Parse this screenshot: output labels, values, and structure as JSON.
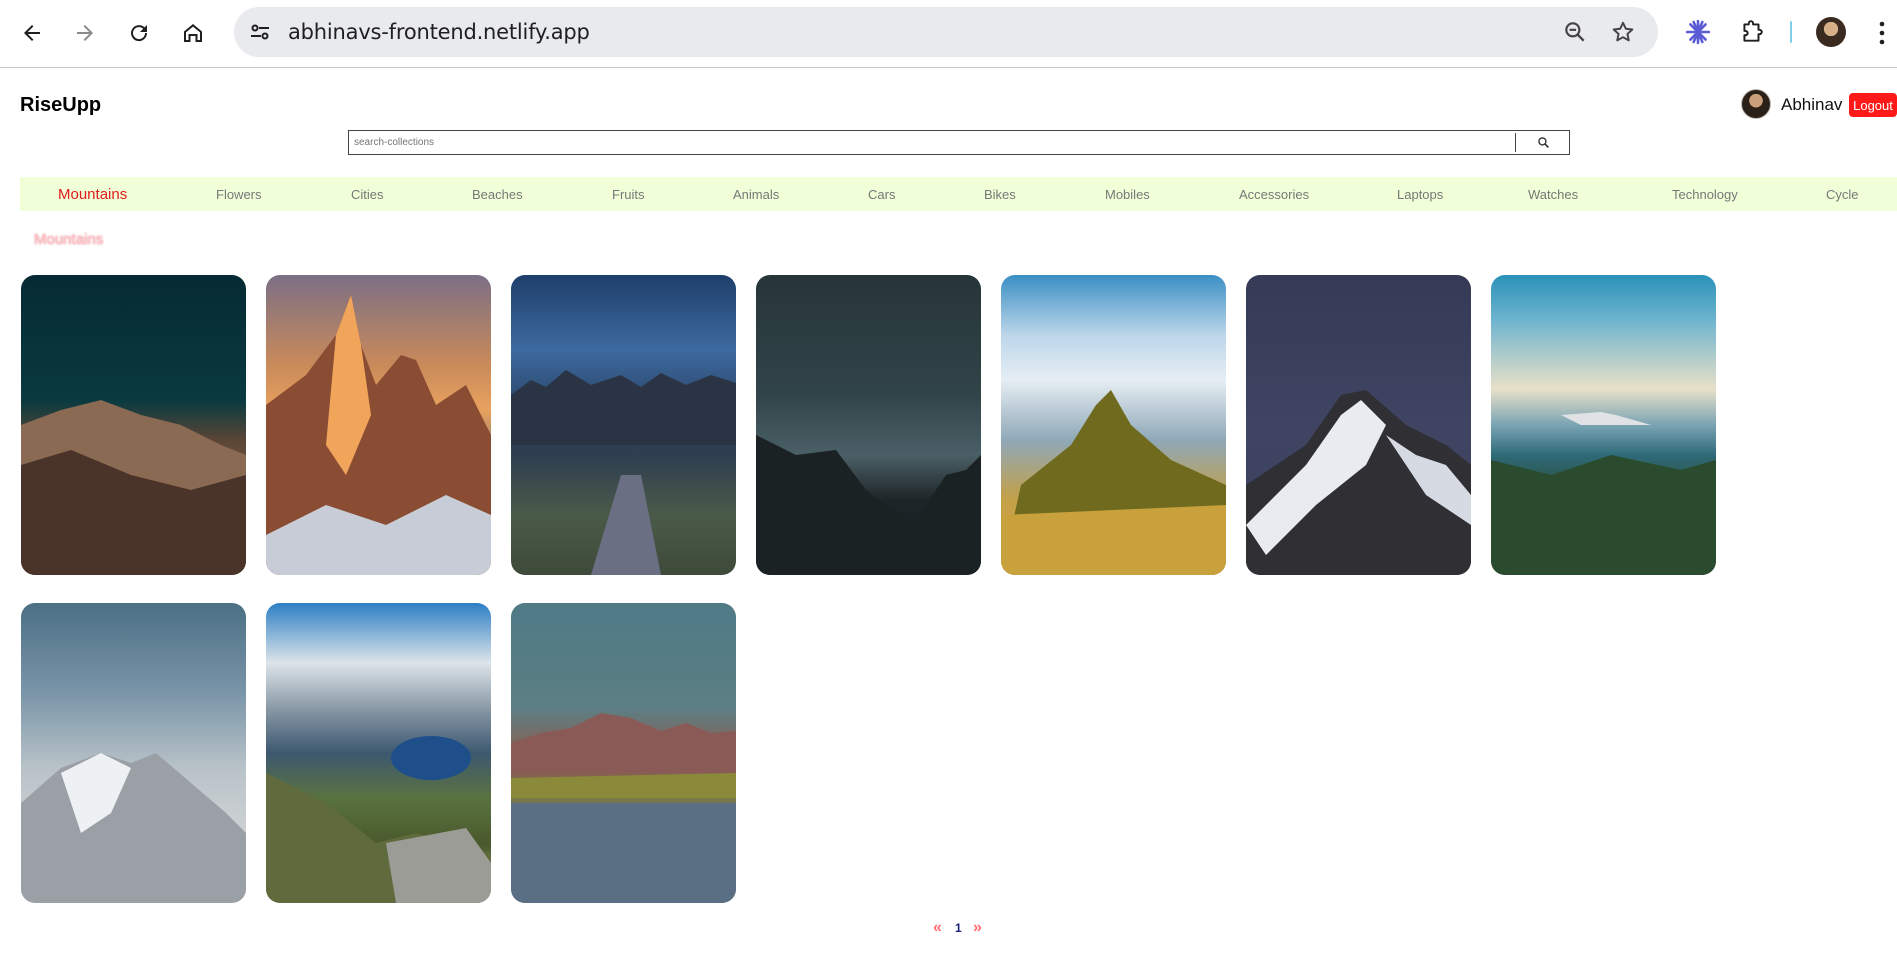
{
  "browser": {
    "url": "abhinavs-frontend.netlify.app"
  },
  "app": {
    "brand": "RiseUpp",
    "user_name": "Abhinav",
    "logout_label": "Logout",
    "search_placeholder": "search-collections"
  },
  "categories": [
    {
      "label": "Mountains",
      "active": true
    },
    {
      "label": "Flowers"
    },
    {
      "label": "Cities"
    },
    {
      "label": "Beaches"
    },
    {
      "label": "Fruits"
    },
    {
      "label": "Animals"
    },
    {
      "label": "Cars"
    },
    {
      "label": "Bikes"
    },
    {
      "label": "Mobiles"
    },
    {
      "label": "Accessories"
    },
    {
      "label": "Laptops"
    },
    {
      "label": "Watches"
    },
    {
      "label": "Technology"
    },
    {
      "label": "Cycle"
    }
  ],
  "section_title": "Mountains",
  "pagination": {
    "prev": "«",
    "current_page": "1",
    "next": "»"
  },
  "colors": {
    "accent_red": "#ff1a1a",
    "category_bar": "#f1ffd8",
    "active_category": "#e01b1b"
  }
}
